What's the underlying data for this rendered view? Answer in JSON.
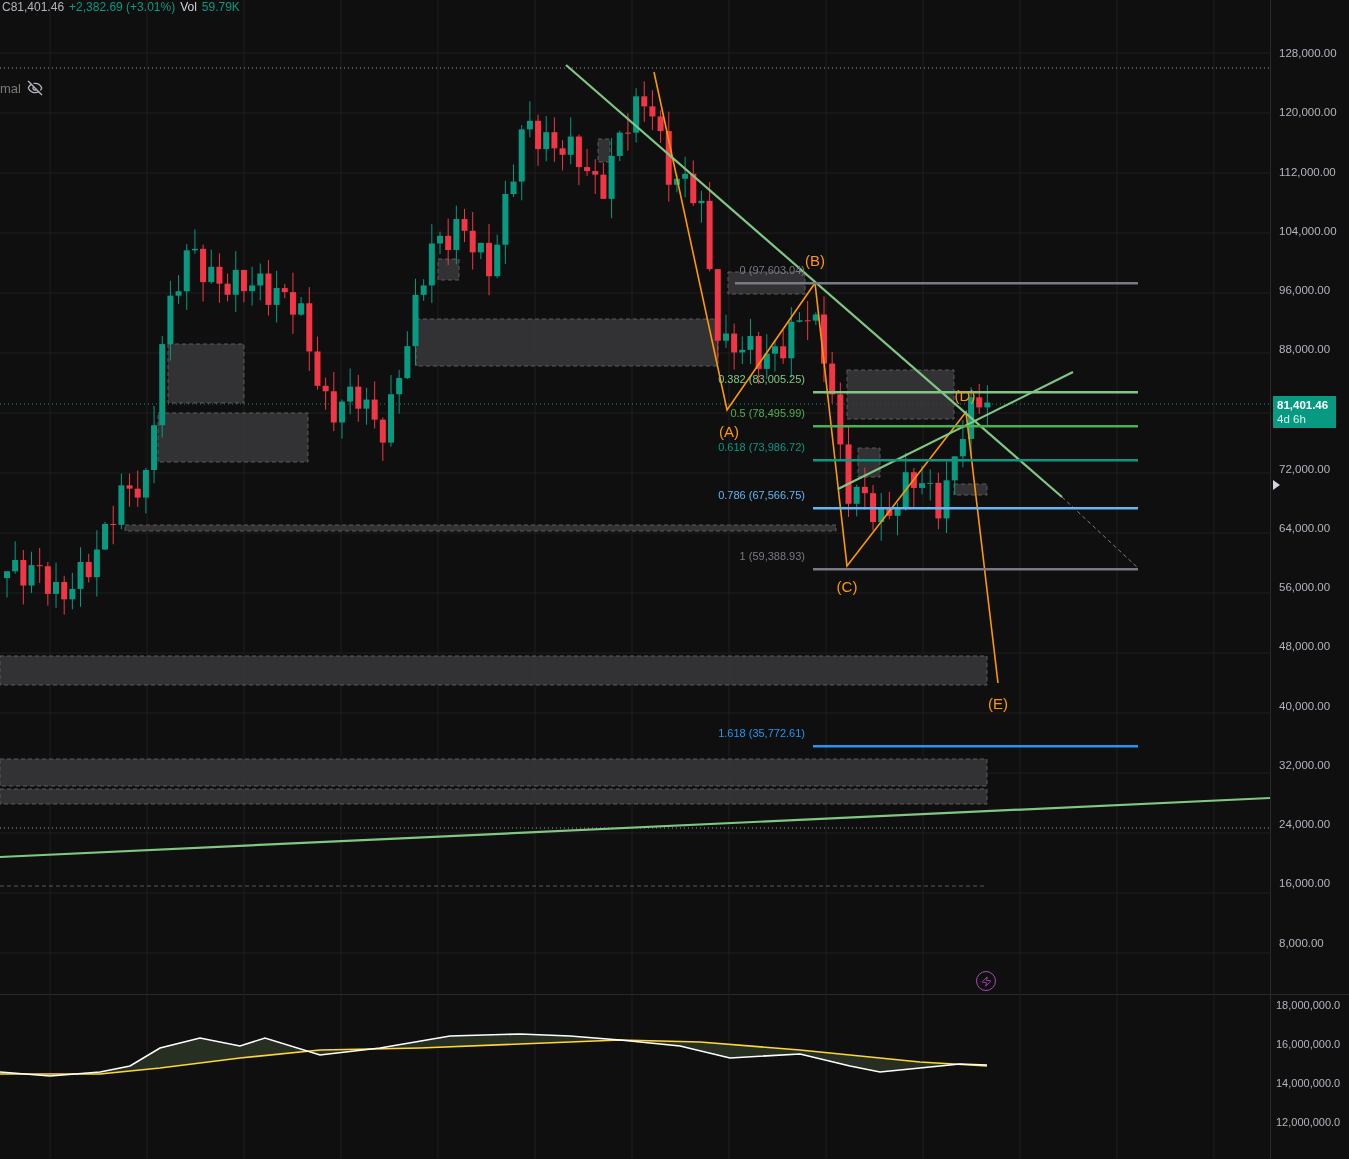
{
  "legend": {
    "close": "C81,401.46",
    "change": "+2,382.69 (+3.01%)",
    "volume_label": "Vol",
    "volume": "59.79K"
  },
  "indicator": {
    "name": "mal",
    "visible": false
  },
  "fib_levels": [
    {
      "label": "0 (97,603.04)",
      "color": "#787b86"
    },
    {
      "label": "0.382 (83,005.25)",
      "color": "#81c784"
    },
    {
      "label": "0.5 (78,495.99)",
      "color": "#4caf50"
    },
    {
      "label": "0.618 (73,986.72)",
      "color": "#089981"
    },
    {
      "label": "0.786 (67,566.75)",
      "color": "#64b5f6"
    },
    {
      "label": "1 (59,388.93)",
      "color": "#787b86"
    },
    {
      "label": "1.618 (35,772.61)",
      "color": "#2196f3"
    }
  ],
  "waves": [
    {
      "label": "(A)"
    },
    {
      "label": "(B)"
    },
    {
      "label": "(C)"
    },
    {
      "label": "(D)"
    },
    {
      "label": "(E)"
    }
  ],
  "price_axis": {
    "ticks": [
      "128,000.00",
      "120,000.00",
      "112,000.00",
      "104,000.00",
      "96,000.00",
      "88,000.00",
      "72,000.00",
      "64,000.00",
      "56,000.00",
      "48,000.00",
      "40,000.00",
      "32,000.00",
      "24,000.00",
      "16,000.00",
      "8,000.00"
    ],
    "last_price": "81,401.46",
    "countdown": "4d 6h"
  },
  "volume_axis": {
    "ticks": [
      "18,000,000.0",
      "16,000,000.0",
      "14,000,000.0",
      "12,000,000.0"
    ]
  }
}
